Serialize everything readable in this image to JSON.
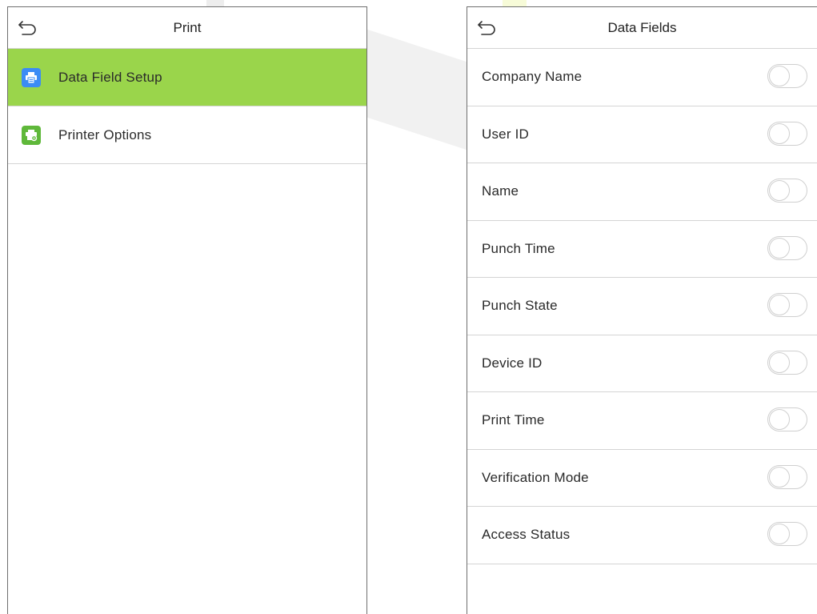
{
  "left_panel": {
    "title": "Print",
    "items": [
      {
        "label": "Data Field Setup",
        "icon": "printer-icon",
        "icon_color": "#3b8cf5",
        "selected": true
      },
      {
        "label": "Printer Options",
        "icon": "printer-settings-icon",
        "icon_color": "#5fb83a",
        "selected": false
      }
    ]
  },
  "right_panel": {
    "title": "Data Fields",
    "fields": [
      {
        "label": "Company Name",
        "enabled": false
      },
      {
        "label": "User ID",
        "enabled": false
      },
      {
        "label": "Name",
        "enabled": false
      },
      {
        "label": "Punch Time",
        "enabled": false
      },
      {
        "label": "Punch State",
        "enabled": false
      },
      {
        "label": "Device ID",
        "enabled": false
      },
      {
        "label": "Print Time",
        "enabled": false
      },
      {
        "label": "Verification Mode",
        "enabled": false
      },
      {
        "label": "Access Status",
        "enabled": false
      }
    ]
  },
  "colors": {
    "selected_row": "#9ad54b",
    "border": "#d4d4d4"
  }
}
